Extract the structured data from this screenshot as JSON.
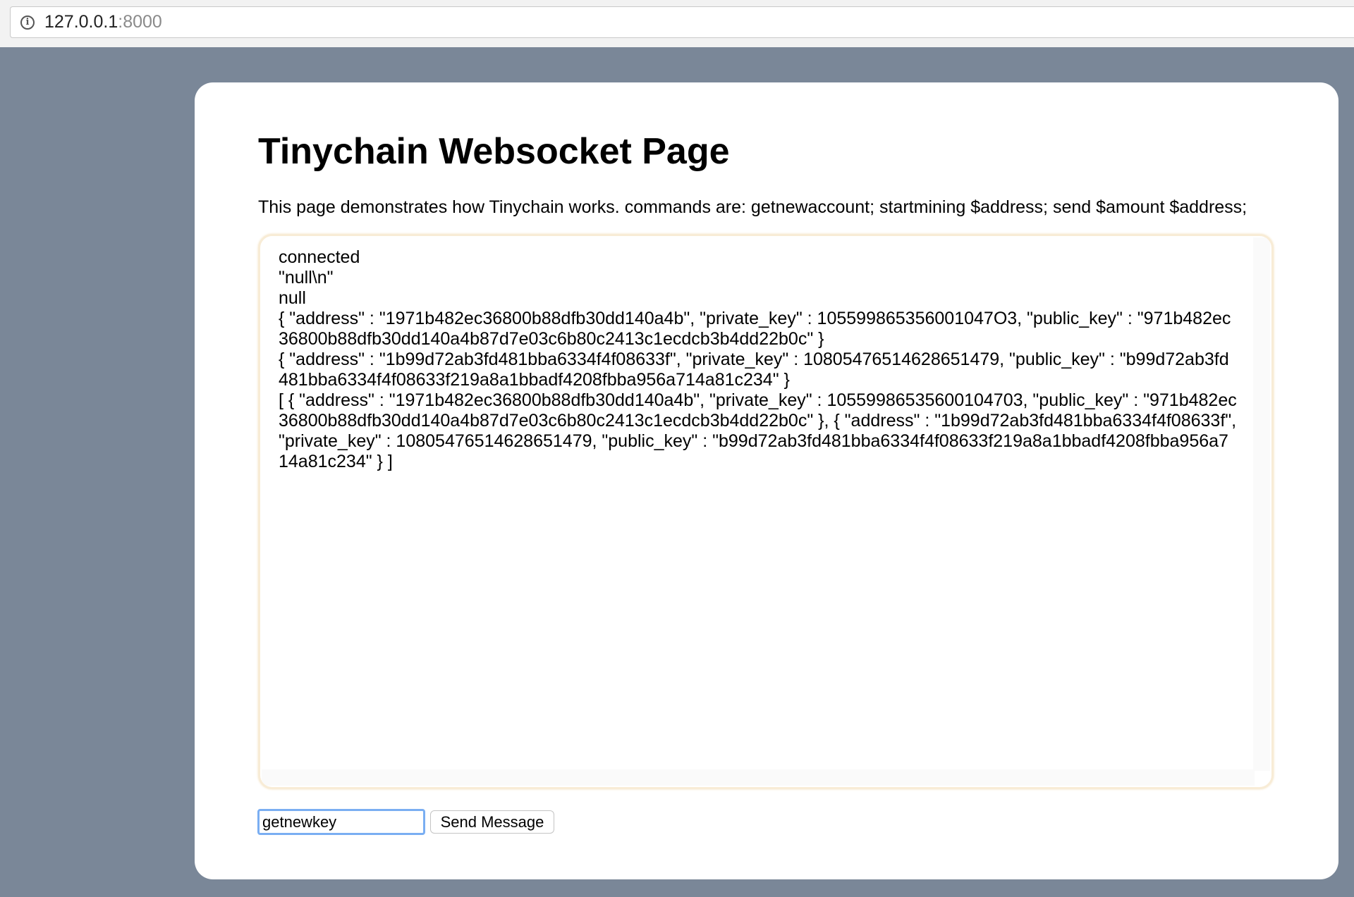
{
  "browser": {
    "url_host": "127.0.0.1",
    "url_port": ":8000"
  },
  "page": {
    "title": "Tinychain Websocket Page",
    "intro": "This page demonstrates how Tinychain works. commands are: getnewaccount; startmining $address; send $amount $address;"
  },
  "log": {
    "lines": [
      "connected",
      "\"null\\n\"",
      "null",
      "{ \"address\" : \"1971b482ec36800b88dfb30dd140a4b\", \"private_key\" : 105599865356001047O3, \"public_key\" : \"971b482ec36800b88dfb30dd140a4b87d7e03c6b80c2413c1ecdcb3b4dd22b0c\" }",
      "{ \"address\" : \"1b99d72ab3fd481bba6334f4f08633f\", \"private_key\" : 10805476514628651479, \"public_key\" : \"b99d72ab3fd481bba6334f4f08633f219a8a1bbadf4208fbba956a714a81c234\" }",
      "[ { \"address\" : \"1971b482ec36800b88dfb30dd140a4b\", \"private_key\" : 10559986535600104703, \"public_key\" : \"971b482ec36800b88dfb30dd140a4b87d7e03c6b80c2413c1ecdcb3b4dd22b0c\" }, { \"address\" : \"1b99d72ab3fd481bba6334f4f08633f\", \"private_key\" : 10805476514628651479, \"public_key\" : \"b99d72ab3fd481bba6334f4f08633f219a8a1bbadf4208fbba956a714a81c234\" } ]"
    ]
  },
  "form": {
    "input_value": "getnewkey",
    "send_label": "Send Message"
  }
}
